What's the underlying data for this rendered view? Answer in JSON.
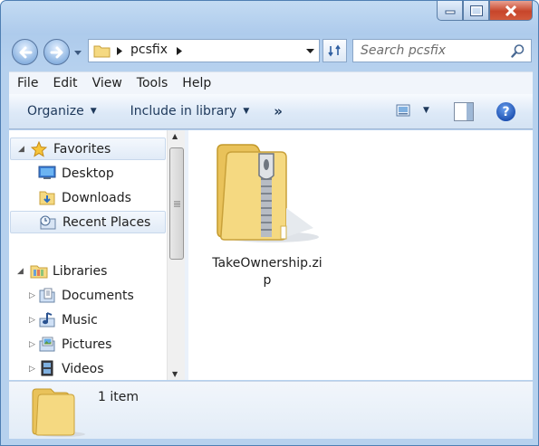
{
  "window": {
    "minimize_icon": "minimize-icon",
    "maximize_icon": "maximize-icon",
    "close_icon": "close-icon"
  },
  "navigation": {
    "address": {
      "segments": [
        "pcsfix"
      ]
    },
    "search": {
      "placeholder": "Search pcsfix"
    }
  },
  "menu": {
    "items": [
      "File",
      "Edit",
      "View",
      "Tools",
      "Help"
    ]
  },
  "commands": {
    "organize": "Organize",
    "include": "Include in library",
    "more": "»",
    "help": "?"
  },
  "nav_pane": {
    "favorites": {
      "label": "Favorites",
      "items": [
        "Desktop",
        "Downloads",
        "Recent Places"
      ]
    },
    "libraries": {
      "label": "Libraries",
      "items": [
        "Documents",
        "Music",
        "Pictures",
        "Videos"
      ]
    }
  },
  "files": [
    {
      "name": "TakeOwnership.zip",
      "icon": "zip-folder-icon"
    }
  ],
  "details_pane": {
    "count_text": "1 item"
  },
  "colors": {
    "frame": "#b6d1ee",
    "selection": "#e1ebf7",
    "close_button": "#c7452a",
    "folder_yellow": "#f5d981"
  }
}
